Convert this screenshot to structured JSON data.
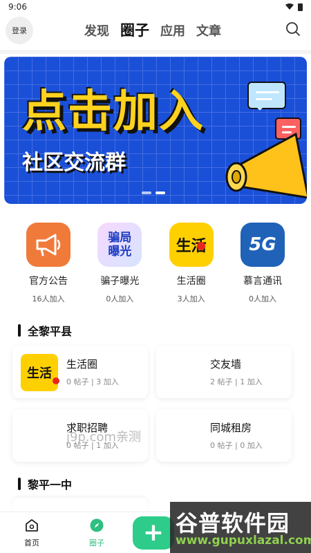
{
  "status": {
    "time": "9:06"
  },
  "header": {
    "login_label": "登录",
    "tabs": [
      {
        "label": "发现",
        "active": false
      },
      {
        "label": "圈子",
        "active": true
      },
      {
        "label": "应用",
        "active": false
      },
      {
        "label": "文章",
        "active": false
      }
    ]
  },
  "banner": {
    "title": "点击加入",
    "subtitle": "社区交流群",
    "slides": 2,
    "active_slide": 2
  },
  "circles": [
    {
      "name": "官方公告",
      "count": "16人加入",
      "icon": "megaphone-icon",
      "color": "#f07a3a"
    },
    {
      "name": "骗子曝光",
      "count": "0人加入",
      "icon": "scam-exposure-icon",
      "icon_text": "骗局曝光"
    },
    {
      "name": "生活圈",
      "count": "3人加入",
      "icon": "life-circle-icon",
      "icon_text": "生活"
    },
    {
      "name": "慕言通讯",
      "count": "0人加入",
      "icon": "5g-icon",
      "icon_text": "5G"
    }
  ],
  "sections": [
    {
      "title": "全黎平县",
      "cards": [
        {
          "name": "生活圈",
          "meta": "0 帖子 | 3 加入",
          "logo_text": "生活"
        },
        {
          "name": "交友墙",
          "meta": "2 帖子 | 1 加入"
        },
        {
          "name": "求职招聘",
          "meta": "0 帖子 | 1 加入"
        },
        {
          "name": "同城租房",
          "meta": "0 帖子 | 0 加入"
        }
      ]
    },
    {
      "title": "黎平一中"
    }
  ],
  "watermarks": {
    "j9p": "j9p.com亲测",
    "brand_title": "谷普软件园",
    "brand_url": "www.gupuxlazal.com"
  },
  "bottom_nav": {
    "items": [
      {
        "label": "首页",
        "icon": "home-icon",
        "active": false
      },
      {
        "label": "圈子",
        "icon": "compass-icon",
        "active": true
      }
    ],
    "add_label": "+"
  },
  "colors": {
    "accent": "#2fbf80",
    "banner_bg": "#1a4fd8",
    "banner_title": "#ffd21f"
  }
}
